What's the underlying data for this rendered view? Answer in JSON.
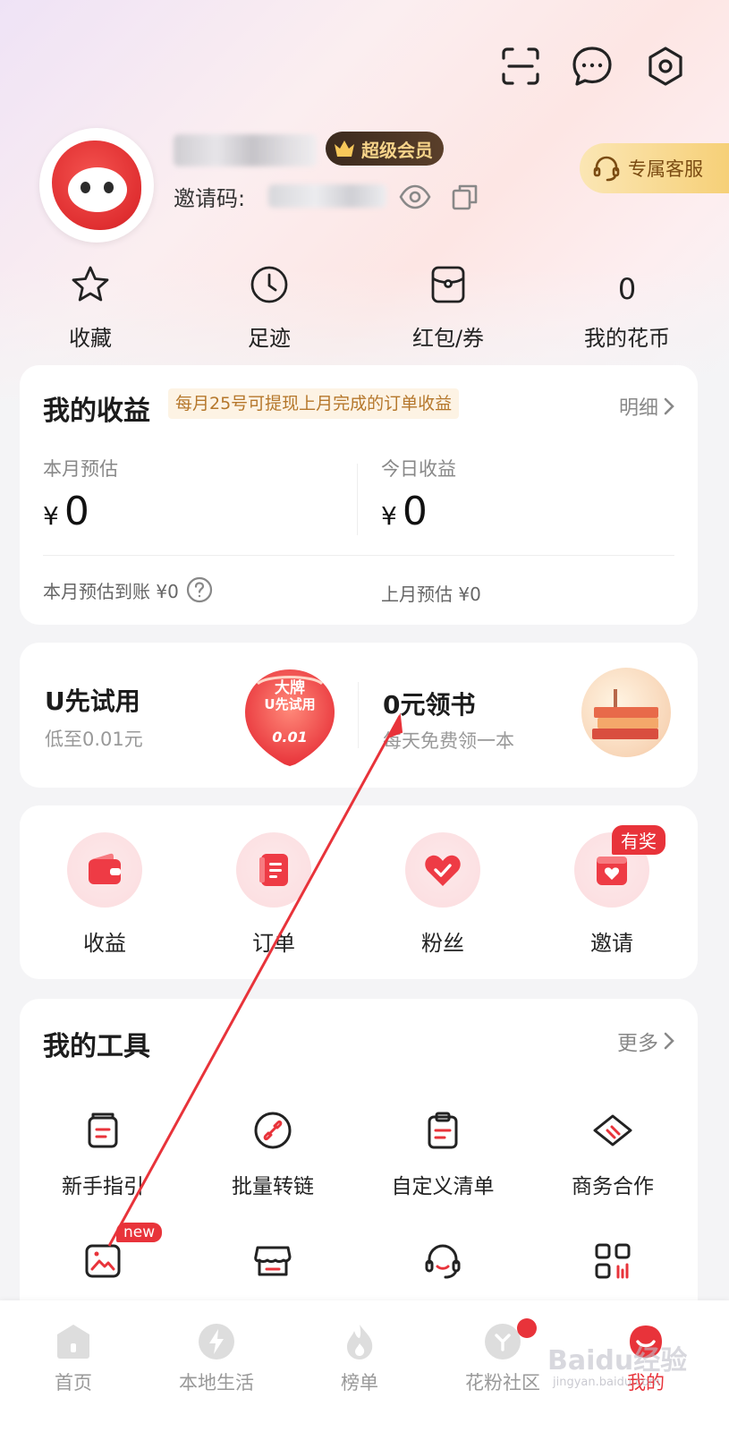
{
  "header": {
    "vip_label": "超级会员",
    "invite_label": "邀请码:",
    "customer_service_label": "专属客服"
  },
  "quick": {
    "items": [
      {
        "label": "收藏",
        "icon": "star-icon"
      },
      {
        "label": "足迹",
        "icon": "clock-icon"
      },
      {
        "label": "红包/券",
        "icon": "coupon-icon"
      },
      {
        "label": "我的花币",
        "value": "0"
      }
    ]
  },
  "earnings": {
    "title": "我的收益",
    "tip": "每月25号可提现上月完成的订单收益",
    "detail_label": "明细",
    "month_label": "本月预估",
    "month_value": "0",
    "today_label": "今日收益",
    "today_value": "0",
    "currency": "¥",
    "month_arrival": "本月预估到账 ¥0",
    "last_month": "上月预估 ¥0"
  },
  "promo": {
    "left_title": "U先试用",
    "left_sub": "低至0.01元",
    "left_badge_top": "大牌",
    "left_badge_mid": "U先试用",
    "left_badge_price": "0.01",
    "right_title": "0元领书",
    "right_sub": "每天免费领一本"
  },
  "functions": {
    "items": [
      {
        "label": "收益",
        "icon": "wallet-icon"
      },
      {
        "label": "订单",
        "icon": "order-icon"
      },
      {
        "label": "粉丝",
        "icon": "heart-check-icon"
      },
      {
        "label": "邀请",
        "icon": "invite-icon"
      }
    ],
    "reward_tag": "有奖"
  },
  "tools": {
    "title": "我的工具",
    "more_label": "更多",
    "items": [
      {
        "label": "新手指引",
        "icon": "guide-icon"
      },
      {
        "label": "批量转链",
        "icon": "link-icon"
      },
      {
        "label": "自定义清单",
        "icon": "clipboard-icon"
      },
      {
        "label": "商务合作",
        "icon": "handshake-icon"
      }
    ],
    "new_tag": "new"
  },
  "nav": {
    "items": [
      {
        "label": "首页",
        "icon": "home-icon"
      },
      {
        "label": "本地生活",
        "icon": "lightning-icon"
      },
      {
        "label": "榜单",
        "icon": "fire-icon"
      },
      {
        "label": "花粉社区",
        "icon": "community-icon"
      },
      {
        "label": "我的",
        "icon": "mine-icon"
      }
    ]
  },
  "watermark": {
    "brand": "Baidu经验",
    "site": "jingyan.baidu.com"
  },
  "colors": {
    "accent": "#e8333a",
    "vip_gold": "#f7d48a",
    "tip_text": "#b5772b"
  }
}
